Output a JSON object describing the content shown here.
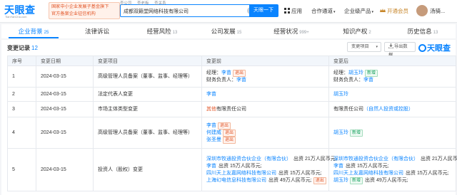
{
  "header": {
    "logo": "天眼查",
    "logo_sub": "TianYanCha.com",
    "banner_line1": "国家中小企业发展子基金旗下",
    "banner_line2": "官方备案企业征信机构",
    "search_tabs": [
      "查公司",
      "查老板",
      "查关系"
    ],
    "search_value": "成都双籁堂网络科技有限公司",
    "search_button": "天眼一下",
    "nav": [
      {
        "label": "应用"
      },
      {
        "label": "合作通道"
      },
      {
        "label": "企业级产品"
      },
      {
        "label": "开通会员"
      },
      {
        "label": "汤骑..."
      }
    ]
  },
  "tabs": [
    {
      "label": "企业背景",
      "count": "25"
    },
    {
      "label": "法律诉讼",
      "count": ""
    },
    {
      "label": "经营风险",
      "count": "13"
    },
    {
      "label": "公司发展",
      "count": "15"
    },
    {
      "label": "经营状况",
      "count": "999+"
    },
    {
      "label": "知识产权",
      "count": "2"
    },
    {
      "label": "历史信息",
      "count": "13"
    }
  ],
  "section": {
    "title": "变更记录",
    "count": "12",
    "filter_label": "变更项目",
    "export_label": "导出数据",
    "watermark": "天眼查"
  },
  "table": {
    "headers": [
      "序号",
      "变更日期",
      "变更项目",
      "变更前",
      "变更后"
    ],
    "rows": [
      {
        "no": "1",
        "date": "2024-03-15",
        "item": "高级管理人员备案（董事、监事、经理等）",
        "before": [
          {
            "pre": "经理：",
            "link": "李苗",
            "tag": "退出",
            "tag_type": "out",
            "post": ""
          },
          {
            "pre": "财务负责人：",
            "link": "李苗",
            "tag": "",
            "tag_type": "",
            "post": ""
          }
        ],
        "after": [
          {
            "pre": "经理：",
            "link": "胡玉玲",
            "tag": "新增",
            "tag_type": "new",
            "post": ""
          },
          {
            "pre": "财务负责人：",
            "link": "李苗",
            "tag": "",
            "tag_type": "",
            "post": ""
          }
        ]
      },
      {
        "no": "2",
        "date": "2024-03-15",
        "item": "法定代表人变更",
        "before": [
          {
            "pre": "",
            "link": "李苗",
            "tag": "",
            "tag_type": "",
            "post": ""
          }
        ],
        "after": [
          {
            "pre": "",
            "link": "胡玉玲",
            "tag": "",
            "tag_type": "",
            "post": ""
          }
        ]
      },
      {
        "no": "3",
        "date": "2024-03-15",
        "item": "市场主体类型变更",
        "before": [
          {
            "pre": "",
            "link": "",
            "tag": "",
            "tag_type": "",
            "post": "其他有限责任公司",
            "hl": "其他"
          }
        ],
        "after": [
          {
            "pre": "",
            "link": "",
            "tag": "",
            "tag_type": "",
            "post": "有限责任公司",
            "hl": "（自然人投资或控股）"
          }
        ]
      },
      {
        "no": "4",
        "date": "2024-03-15",
        "item": "高级管理人员备案（董事、监事、经理等）",
        "before": [
          {
            "pre": "",
            "link": "李苗",
            "tag": "退出",
            "tag_type": "out",
            "post": ""
          },
          {
            "pre": "",
            "link": "何建威",
            "tag": "退出",
            "tag_type": "out",
            "post": ""
          },
          {
            "pre": "",
            "link": "张圣曼",
            "tag": "退出",
            "tag_type": "out",
            "post": ""
          }
        ],
        "after": [
          {
            "pre": "",
            "link": "胡玉玲",
            "tag": "新增",
            "tag_type": "new",
            "post": ""
          }
        ]
      },
      {
        "no": "5",
        "date": "2024-03-15",
        "item": "投资人（股权）变更",
        "before": [
          {
            "pre": "",
            "link": "深圳市牧通投资合伙企业（有限合伙）",
            "tag": "",
            "tag_type": "",
            "post": "出资 21万人民币元;"
          },
          {
            "pre": "",
            "link": "李苗",
            "tag": "",
            "tag_type": "",
            "post": "出资 15万人民币元;"
          },
          {
            "pre": "",
            "link": "四川天上友嘉网络科技有限公司",
            "tag": "",
            "tag_type": "",
            "post": "出资 15万人民币元;"
          },
          {
            "pre": "",
            "link": "上海幻电信息科技有限公司",
            "tag": "退出",
            "tag_type": "out",
            "post": "出资 49万人民币元;"
          }
        ],
        "after": [
          {
            "pre": "",
            "link": "深圳市牧通投资合伙企业（有限合伙）",
            "tag": "",
            "tag_type": "",
            "post": "出资 21万人民币元;"
          },
          {
            "pre": "",
            "link": "李苗",
            "tag": "",
            "tag_type": "",
            "post": "出资 15万人民币元;"
          },
          {
            "pre": "",
            "link": "四川天上友嘉网络科技有限公司",
            "tag": "",
            "tag_type": "",
            "post": "出资 15万人民币元;"
          },
          {
            "pre": "",
            "link": "胡玉玲",
            "tag": "新增",
            "tag_type": "new",
            "post": "出资 49万人民币元;"
          }
        ]
      }
    ]
  }
}
